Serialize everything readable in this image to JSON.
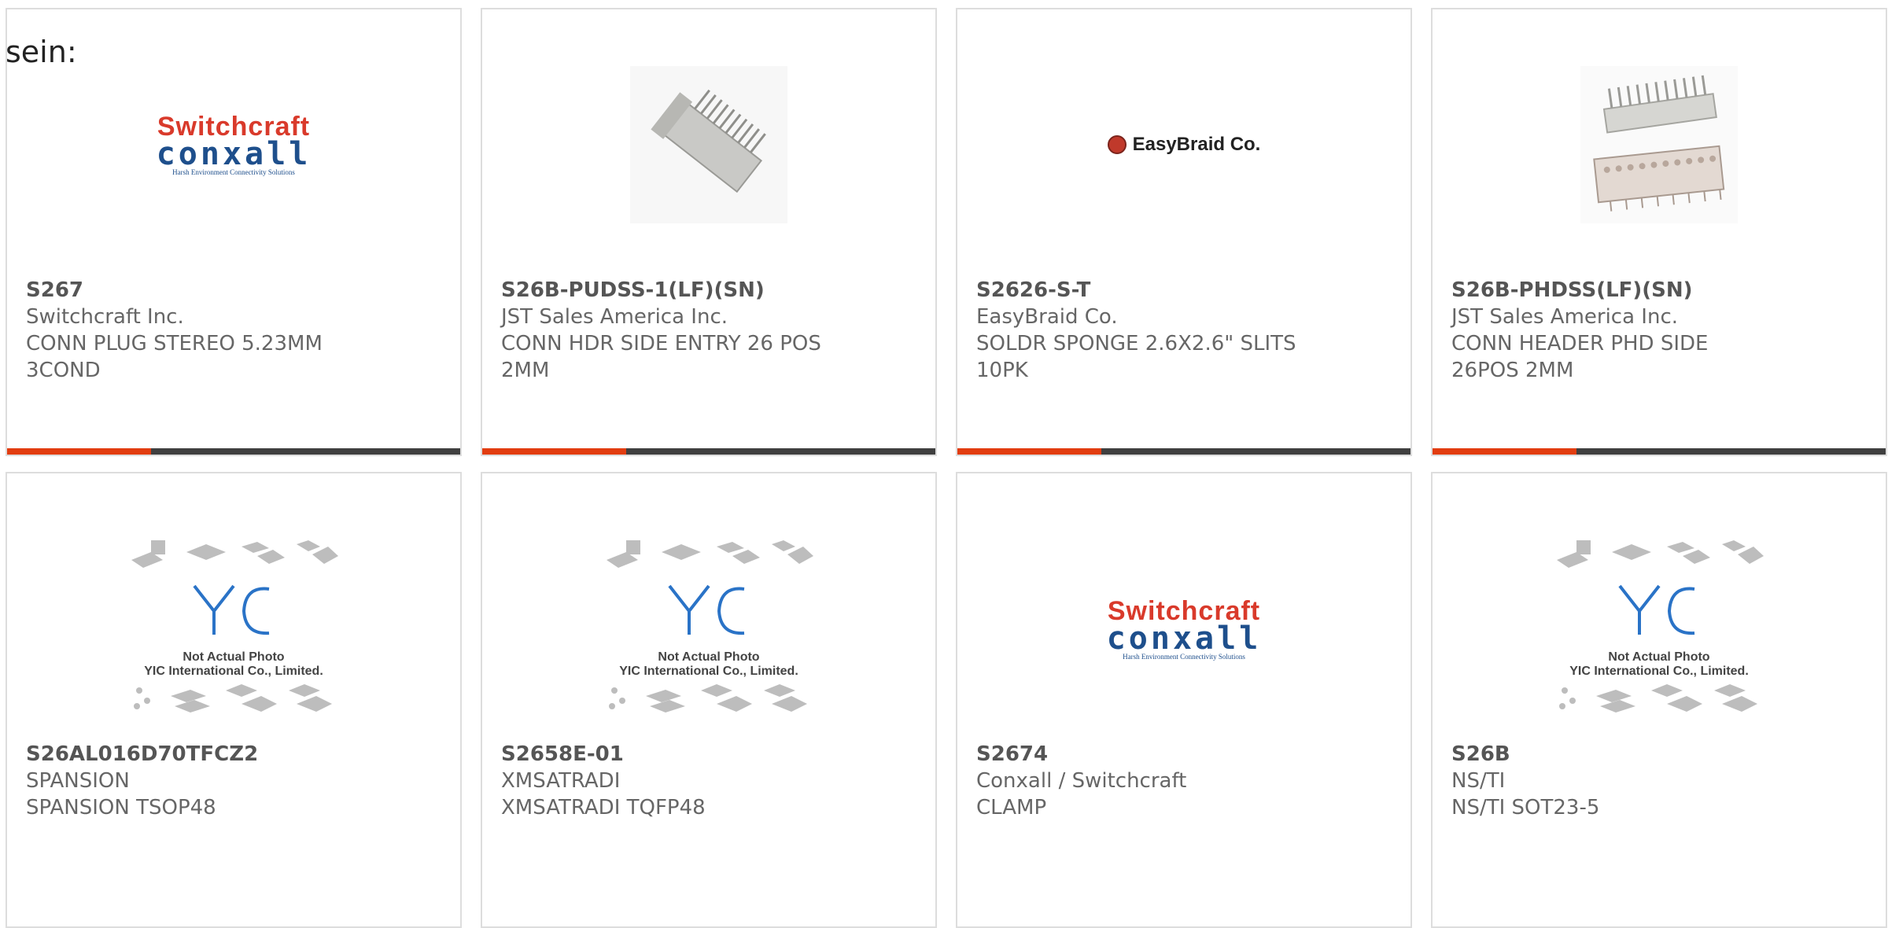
{
  "overlay_text": "sein:",
  "cards": [
    {
      "part_number": "S267",
      "manufacturer": "Switchcraft Inc.",
      "description": "CONN PLUG STEREO 5.23MM 3COND",
      "image": "switchcraft-conxall-logo"
    },
    {
      "part_number": "S26B-PUDSS-1(LF)(SN)",
      "manufacturer": "JST Sales America Inc.",
      "description": "CONN HDR SIDE ENTRY 26 POS 2MM",
      "image": "connector-header-photo"
    },
    {
      "part_number": "S2626-S-T",
      "manufacturer": "EasyBraid Co.",
      "description": "SOLDR SPONGE 2.6X2.6\" SLITS 10PK",
      "image": "easybraid-logo"
    },
    {
      "part_number": "S26B-PHDSS(LF)(SN)",
      "manufacturer": "JST Sales America Inc.",
      "description": "CONN HEADER PHD SIDE 26POS 2MM",
      "image": "connector-header-photo"
    },
    {
      "part_number": "S26AL016D70TFCZ2",
      "manufacturer": "SPANSION",
      "description": "SPANSION TSOP48",
      "image": "not-actual-photo-placeholder"
    },
    {
      "part_number": "S2658E-01",
      "manufacturer": "XMSATRADI",
      "description": "XMSATRADI TQFP48",
      "image": "not-actual-photo-placeholder"
    },
    {
      "part_number": "S2674",
      "manufacturer": "Conxall / Switchcraft",
      "description": "CLAMP",
      "image": "switchcraft-conxall-logo"
    },
    {
      "part_number": "S26B",
      "manufacturer": "NS/TI",
      "description": "NS/TI SOT23-5",
      "image": "not-actual-photo-placeholder"
    }
  ],
  "logos": {
    "switchcraft_top": "Switchcraft",
    "switchcraft_mid": "conxall",
    "switchcraft_tag": "Harsh Environment Connectivity Solutions",
    "easybraid": "EasyBraid Co.",
    "placeholder_line1": "Not Actual Photo",
    "placeholder_line2": "YIC International Co., Limited."
  },
  "colors": {
    "accent": "#e23d10",
    "bar": "#404040",
    "border": "#dddddd"
  }
}
